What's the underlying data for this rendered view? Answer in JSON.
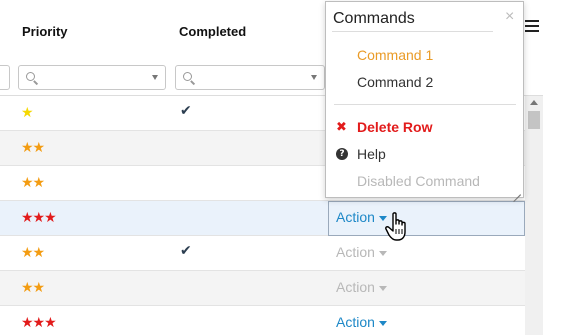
{
  "columns": {
    "priority": "Priority",
    "completed": "Completed"
  },
  "colors": {
    "star_yellow": "#f5d800",
    "star_orange": "#f39c12",
    "star_red": "#e21b1b",
    "link": "#1e88c7",
    "accent_orange": "#ea9b27",
    "danger": "#e21b1b"
  },
  "rows": [
    {
      "stars": "★",
      "star_color": "yellow",
      "completed": "✔",
      "action": "",
      "selected": false
    },
    {
      "stars": "★★",
      "star_color": "orange",
      "completed": "",
      "action": "",
      "selected": false
    },
    {
      "stars": "★★",
      "star_color": "orange",
      "completed": "",
      "action": "",
      "selected": false
    },
    {
      "stars": "★★★",
      "star_color": "red",
      "completed": "",
      "action": "Action",
      "selected": true
    },
    {
      "stars": "★★",
      "star_color": "orange",
      "completed": "✔",
      "action": "Action",
      "selected": false
    },
    {
      "stars": "★★",
      "star_color": "orange",
      "completed": "",
      "action": "Action",
      "selected": false
    },
    {
      "stars": "★★★",
      "star_color": "red",
      "completed": "",
      "action": "Action",
      "selected": false
    }
  ],
  "menu": {
    "title": "Commands",
    "close": "×",
    "items": [
      {
        "label": "Command 1",
        "state": "active"
      },
      {
        "label": "Command 2",
        "state": "normal"
      },
      {
        "label": "Delete Row",
        "state": "danger",
        "icon": "delete-x-icon",
        "glyph": "✖"
      },
      {
        "label": "Help",
        "state": "normal",
        "icon": "help-question-icon",
        "glyph": "?"
      },
      {
        "label": "Disabled Command",
        "state": "disabled"
      }
    ]
  },
  "icons": {
    "search": "search-icon",
    "menu": "hamburger-menu-icon",
    "cursor": "hand-pointer-cursor-icon"
  }
}
